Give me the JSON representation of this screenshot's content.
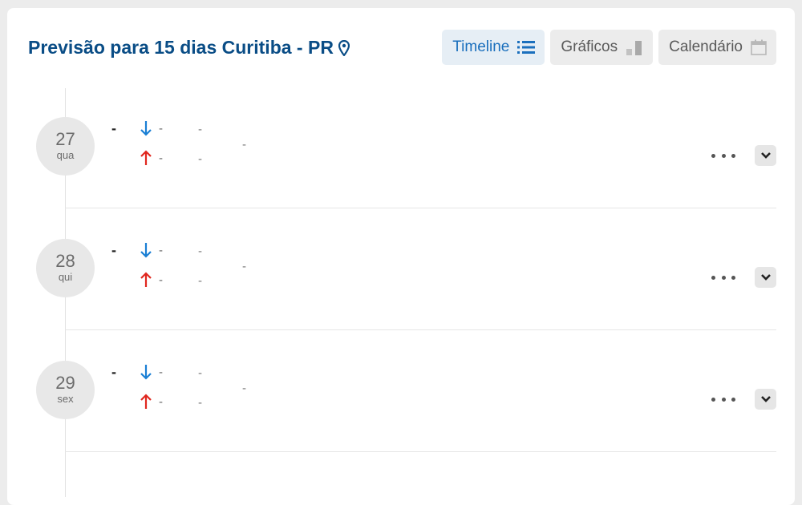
{
  "header": {
    "title": "Previsão para 15 dias Curitiba - PR",
    "title_color": "#0a4d86"
  },
  "tabs": [
    {
      "label": "Timeline",
      "icon": "list-icon",
      "active": true
    },
    {
      "label": "Gráficos",
      "icon": "bar-chart-icon",
      "active": false
    },
    {
      "label": "Calendário",
      "icon": "calendar-icon",
      "active": false
    }
  ],
  "days": [
    {
      "date": "27",
      "weekday": "qua",
      "summary": "-",
      "min": "-",
      "max": "-",
      "min_extra": "-",
      "max_extra": "-",
      "detail": "-"
    },
    {
      "date": "28",
      "weekday": "qui",
      "summary": "-",
      "min": "-",
      "max": "-",
      "min_extra": "-",
      "max_extra": "-",
      "detail": "-"
    },
    {
      "date": "29",
      "weekday": "sex",
      "summary": "-",
      "min": "-",
      "max": "-",
      "min_extra": "-",
      "max_extra": "-",
      "detail": "-"
    }
  ],
  "colors": {
    "min_arrow": "#1a7fd4",
    "max_arrow": "#e0271f",
    "active_tab_text": "#1a6fbd"
  }
}
